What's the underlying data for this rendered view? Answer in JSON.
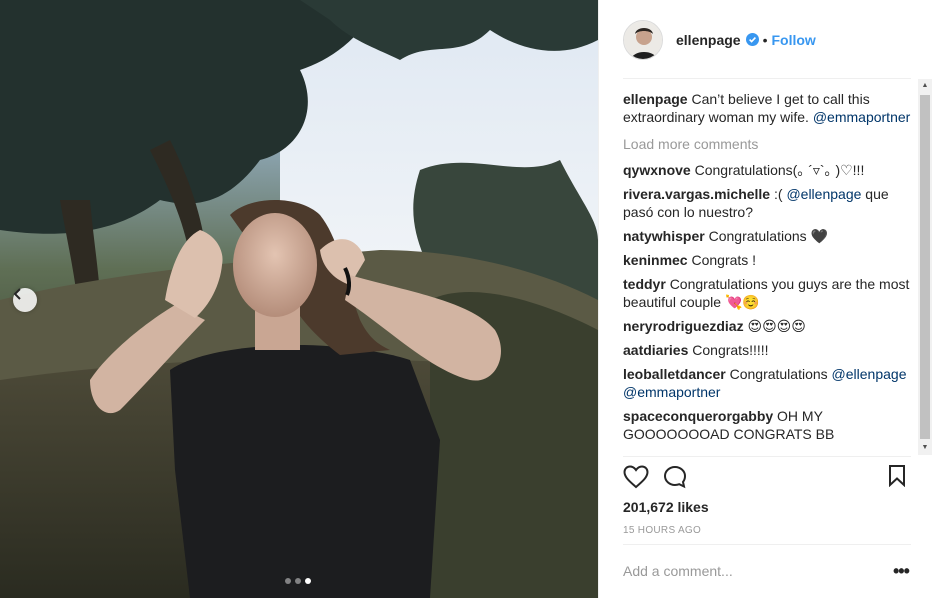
{
  "post": {
    "photo": {
      "alt": "",
      "carousel": {
        "total": 3,
        "active": 3
      }
    },
    "header": {
      "username": "ellenpage",
      "separator": "•",
      "follow_label": "Follow"
    },
    "caption": {
      "username": "ellenpage",
      "text": " Can’t believe I get to call this extraordinary woman my wife. ",
      "mention": "@emmaportner"
    },
    "load_more": "Load more comments",
    "comments": [
      {
        "user": "qywxnove",
        "parts": [
          {
            "t": "Congratulations(｡ ´▿`｡ )♡!!!"
          }
        ]
      },
      {
        "user": "rivera.vargas.michelle",
        "parts": [
          {
            "t": ":( "
          },
          {
            "m": "@ellenpage"
          },
          {
            "t": " que pasó con lo nuestro?"
          }
        ]
      },
      {
        "user": "natywhisper",
        "parts": [
          {
            "t": "Congratulations 🖤"
          }
        ]
      },
      {
        "user": "keninmec",
        "parts": [
          {
            "t": "Congrats !"
          }
        ]
      },
      {
        "user": "teddyr",
        "parts": [
          {
            "t": "Congratulations you guys are the most beautiful couple 💘☺️"
          }
        ]
      },
      {
        "user": "neryrodriguezdiaz",
        "parts": [
          {
            "t": "😍😍😍😍"
          }
        ]
      },
      {
        "user": "aatdiaries",
        "parts": [
          {
            "t": "Congrats!!!!!"
          }
        ]
      },
      {
        "user": "leoballetdancer",
        "parts": [
          {
            "t": "Congratulations "
          },
          {
            "m": "@ellenpage"
          },
          {
            "t": " "
          },
          {
            "m": "@emmaportner"
          }
        ]
      },
      {
        "user": "spaceconquerorgabby",
        "parts": [
          {
            "t": "OH MY GOOOOOOOAD CONGRATS BB"
          }
        ]
      }
    ],
    "likes": "201,672 likes",
    "timestamp": "15 HOURS AGO",
    "add_comment_placeholder": "Add a comment...",
    "more_options": "•••",
    "icons": {
      "like": "heart-icon",
      "comment": "comment-bubble-icon",
      "save": "bookmark-icon",
      "verified": "verified-badge-icon",
      "prev": "chevron-left-icon",
      "avatar": "avatar"
    },
    "colors": {
      "link": "#3897f0",
      "mention": "#003569",
      "muted": "#999999",
      "text": "#262626"
    }
  }
}
